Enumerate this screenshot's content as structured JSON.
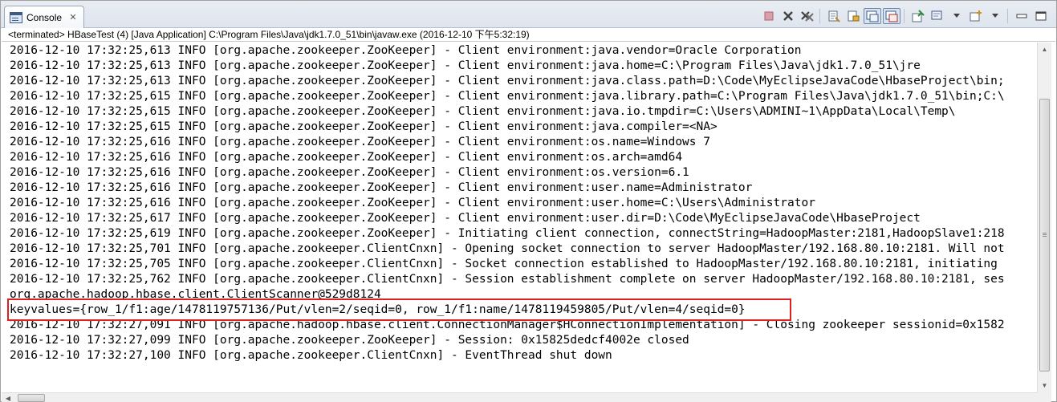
{
  "tab": {
    "label": "Console",
    "close": "✕"
  },
  "toolbar": {
    "icons": [
      "terminate-icon",
      "remove-launch-icon",
      "remove-all-terminated-icon",
      "clear-console-icon",
      "scroll-lock-icon",
      "show-on-stdout-icon",
      "show-on-stderr-icon",
      "pin-console-icon",
      "display-selected-console-icon",
      "open-console-icon",
      "view-menu-icon"
    ]
  },
  "status": "<terminated> HBaseTest (4) [Java Application] C:\\Program Files\\Java\\jdk1.7.0_51\\bin\\javaw.exe (2016-12-10 下午5:32:19)",
  "console": {
    "lines": [
      "2016-12-10 17:32:25,613 INFO [org.apache.zookeeper.ZooKeeper] - Client environment:java.vendor=Oracle Corporation",
      "2016-12-10 17:32:25,613 INFO [org.apache.zookeeper.ZooKeeper] - Client environment:java.home=C:\\Program Files\\Java\\jdk1.7.0_51\\jre",
      "2016-12-10 17:32:25,613 INFO [org.apache.zookeeper.ZooKeeper] - Client environment:java.class.path=D:\\Code\\MyEclipseJavaCode\\HbaseProject\\bin;",
      "2016-12-10 17:32:25,615 INFO [org.apache.zookeeper.ZooKeeper] - Client environment:java.library.path=C:\\Program Files\\Java\\jdk1.7.0_51\\bin;C:\\",
      "2016-12-10 17:32:25,615 INFO [org.apache.zookeeper.ZooKeeper] - Client environment:java.io.tmpdir=C:\\Users\\ADMINI~1\\AppData\\Local\\Temp\\",
      "2016-12-10 17:32:25,615 INFO [org.apache.zookeeper.ZooKeeper] - Client environment:java.compiler=<NA>",
      "2016-12-10 17:32:25,616 INFO [org.apache.zookeeper.ZooKeeper] - Client environment:os.name=Windows 7",
      "2016-12-10 17:32:25,616 INFO [org.apache.zookeeper.ZooKeeper] - Client environment:os.arch=amd64",
      "2016-12-10 17:32:25,616 INFO [org.apache.zookeeper.ZooKeeper] - Client environment:os.version=6.1",
      "2016-12-10 17:32:25,616 INFO [org.apache.zookeeper.ZooKeeper] - Client environment:user.name=Administrator",
      "2016-12-10 17:32:25,616 INFO [org.apache.zookeeper.ZooKeeper] - Client environment:user.home=C:\\Users\\Administrator",
      "2016-12-10 17:32:25,617 INFO [org.apache.zookeeper.ZooKeeper] - Client environment:user.dir=D:\\Code\\MyEclipseJavaCode\\HbaseProject",
      "2016-12-10 17:32:25,619 INFO [org.apache.zookeeper.ZooKeeper] - Initiating client connection, connectString=HadoopMaster:2181,HadoopSlave1:218",
      "2016-12-10 17:32:25,701 INFO [org.apache.zookeeper.ClientCnxn] - Opening socket connection to server HadoopMaster/192.168.80.10:2181. Will not",
      "2016-12-10 17:32:25,705 INFO [org.apache.zookeeper.ClientCnxn] - Socket connection established to HadoopMaster/192.168.80.10:2181, initiating",
      "2016-12-10 17:32:25,762 INFO [org.apache.zookeeper.ClientCnxn] - Session establishment complete on server HadoopMaster/192.168.80.10:2181, ses",
      "org.apache.hadoop.hbase.client.ClientScanner@529d8124",
      "keyvalues={row_1/f1:age/1478119757136/Put/vlen=2/seqid=0, row_1/f1:name/1478119459805/Put/vlen=4/seqid=0}",
      "2016-12-10 17:32:27,091 INFO [org.apache.hadoop.hbase.client.ConnectionManager$HConnectionImplementation] - Closing zookeeper sessionid=0x1582",
      "2016-12-10 17:32:27,099 INFO [org.apache.zookeeper.ZooKeeper] - Session: 0x15825dedcf4002e closed",
      "2016-12-10 17:32:27,100 INFO [org.apache.zookeeper.ClientCnxn] - EventThread shut down"
    ]
  },
  "colors": {
    "highlight_border": "#e02020",
    "terminate": "#c0283a"
  }
}
